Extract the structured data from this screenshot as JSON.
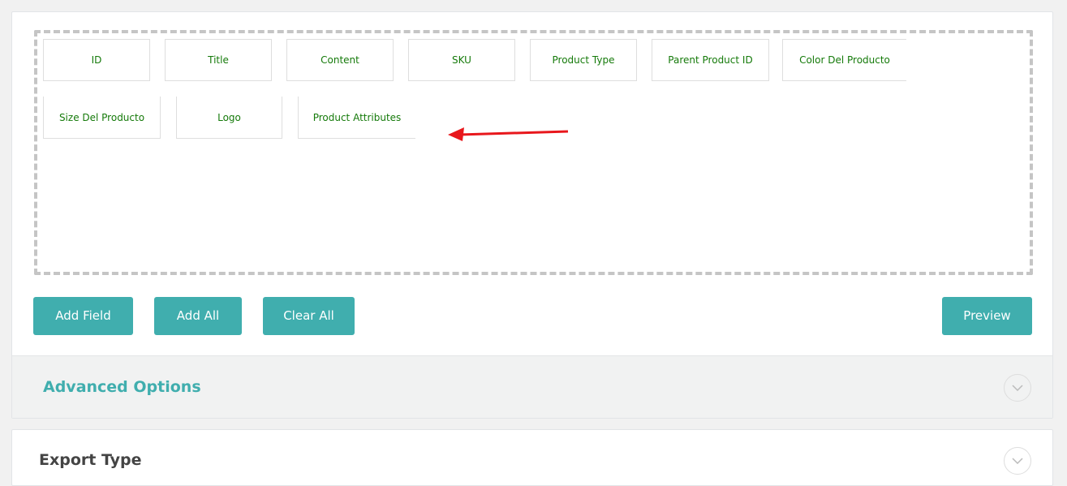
{
  "fields": [
    {
      "label": "ID"
    },
    {
      "label": "Title"
    },
    {
      "label": "Content"
    },
    {
      "label": "SKU"
    },
    {
      "label": "Product Type"
    },
    {
      "label": "Parent Product ID"
    },
    {
      "label": "Color Del Producto"
    },
    {
      "label": "Size Del Producto"
    },
    {
      "label": "Logo"
    },
    {
      "label": "Product Attributes"
    }
  ],
  "buttons": {
    "add_field": "Add Field",
    "add_all": "Add All",
    "clear_all": "Clear All",
    "preview": "Preview"
  },
  "sections": {
    "advanced_options": "Advanced Options",
    "export_type": "Export Type"
  },
  "icons": {
    "annotation_arrow": "arrow-left-icon",
    "expand": "chevron-down-icon"
  },
  "colors": {
    "accent": "#40aeae",
    "field_text": "#157a0a",
    "annotation_arrow": "#e8171c",
    "dashed_border": "#c5c5c5"
  }
}
